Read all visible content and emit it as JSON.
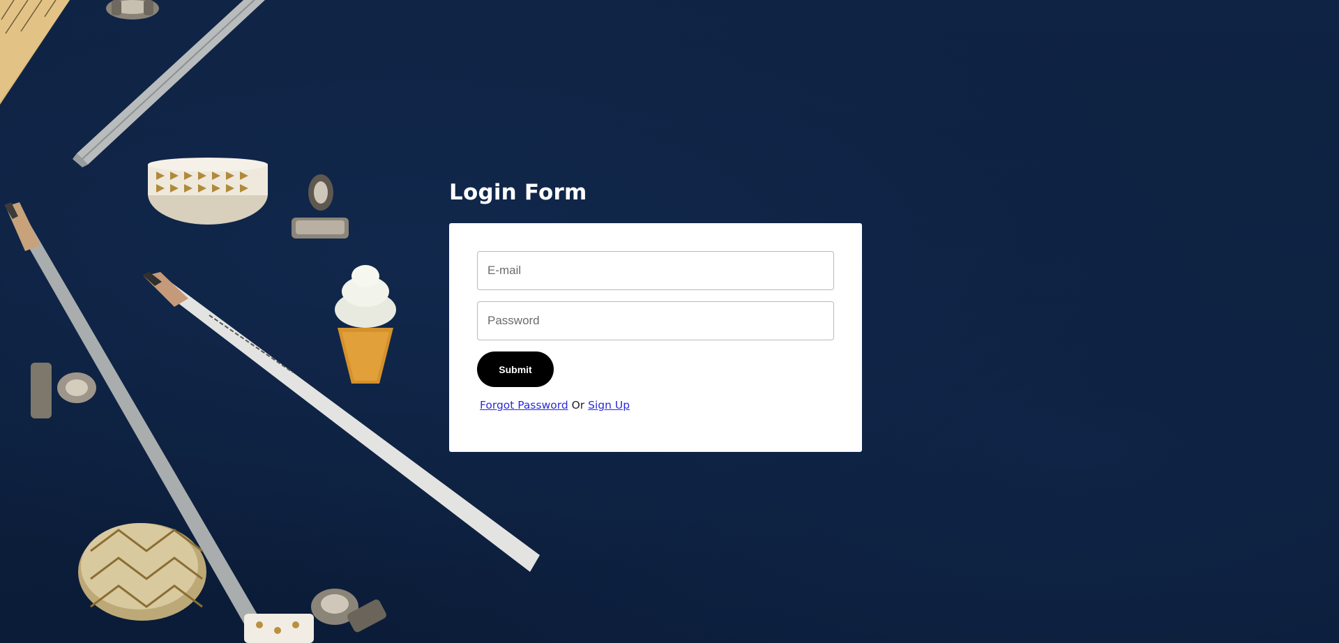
{
  "page": {
    "title": "Login Form"
  },
  "form": {
    "email_placeholder": "E-mail",
    "email_value": "",
    "password_placeholder": "Password",
    "password_value": "",
    "submit_label": "Submit",
    "forgot_label": "Forgot Password",
    "or_text": " Or ",
    "signup_label": "Sign Up"
  },
  "colors": {
    "background": "#0d1f3c",
    "card": "#ffffff",
    "button": "#000000",
    "link": "#2a2ad6"
  },
  "background_image": {
    "description_icons": [
      "ruler-icon",
      "pencil-icon",
      "binder-clip-icon",
      "washi-tape-icon",
      "ice-cream-eraser-icon"
    ]
  }
}
